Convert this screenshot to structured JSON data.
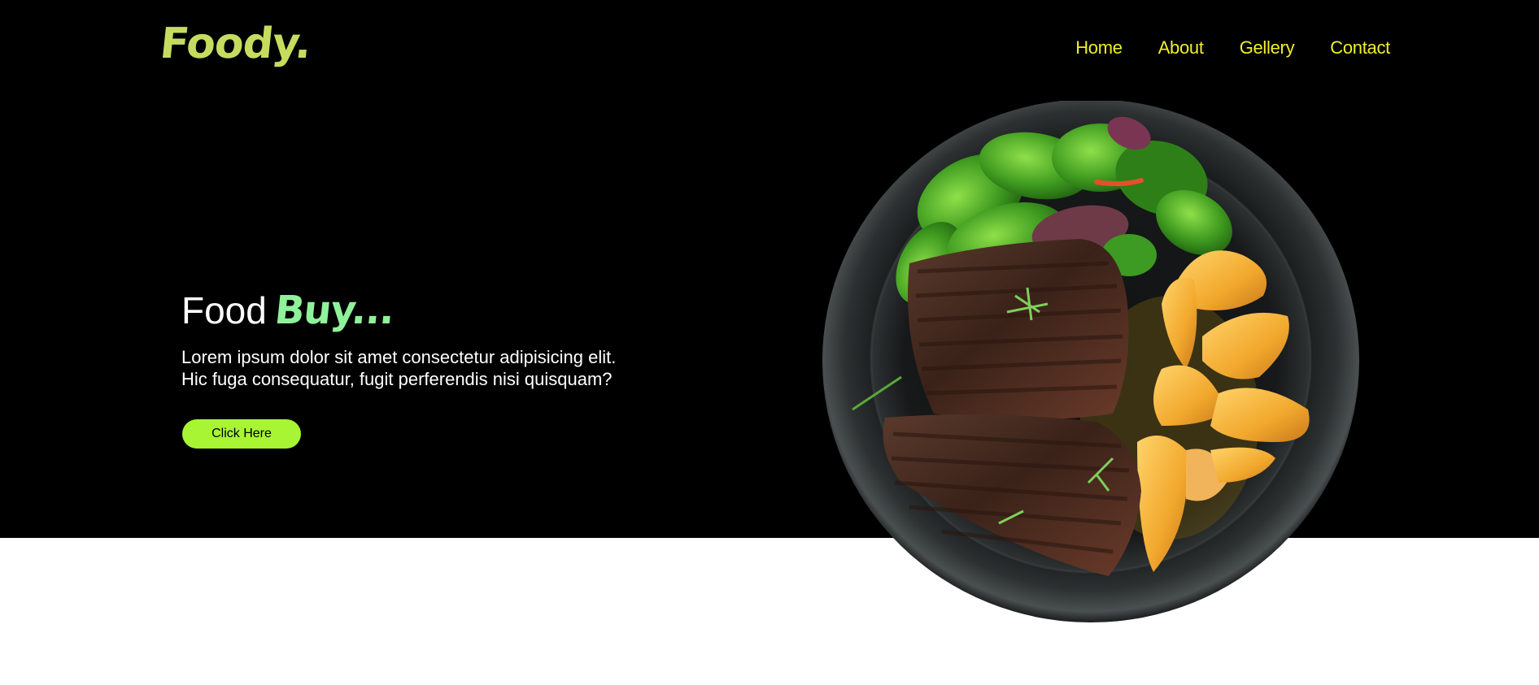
{
  "brand": {
    "logo_text": "Foody.",
    "logo_color": "#c6dc5f"
  },
  "nav": {
    "color": "#f0ef2a",
    "items": [
      {
        "label": "Home"
      },
      {
        "label": "About"
      },
      {
        "label": "Gellery"
      },
      {
        "label": "Contact"
      }
    ]
  },
  "hero": {
    "headline_plain": "Food",
    "headline_accent": "Buy...",
    "accent_color": "#8ff29a",
    "subtext_line1": "Lorem ipsum dolor sit amet consectetur adipisicing elit.",
    "subtext_line2": "Hic fuga consequatur, fugit perferendis nisi quisquam?",
    "cta_label": "Click Here",
    "cta_color": "#a8f534",
    "image": "steak-salad-potato-plate"
  }
}
